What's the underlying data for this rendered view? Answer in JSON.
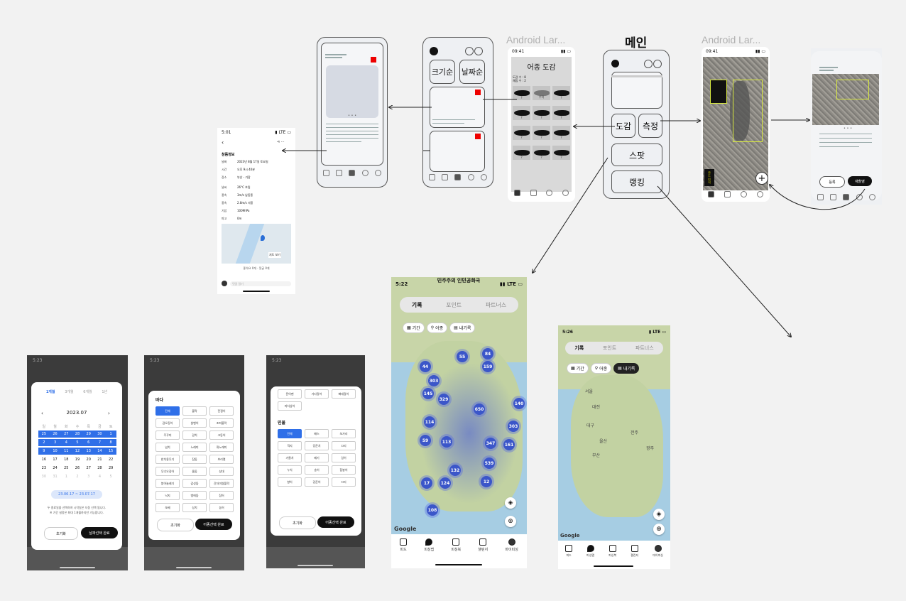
{
  "labels": {
    "android_1": "Android Lar...",
    "android_2": "Android Lar...",
    "main": "메인"
  },
  "wire_main": {
    "btn_dogam": "도감",
    "btn_measure": "측정",
    "btn_spot": "스팟",
    "btn_ranking": "랭킹"
  },
  "wire_sort": {
    "btn_size": "크기순",
    "btn_date": "날짜순"
  },
  "dogam": {
    "status_time": "09:41",
    "title": "어종 도감",
    "sub1": "도감 수 : 8",
    "sub2": "채집 수 : 2",
    "fish_captions": [
      "?",
      "우럭",
      "?",
      "?",
      "?",
      "?",
      "?",
      "?",
      "?",
      "?",
      "?",
      "?"
    ]
  },
  "measure": {
    "status_time": "09:41",
    "badge": "카드 인식"
  },
  "result": {
    "btn_register": "등록",
    "btn_retake": "재촬영"
  },
  "detail": {
    "status_time": "5:01",
    "title": "참돔정보",
    "rows": [
      {
        "k": "날짜",
        "v": "2023년 8월 17일 토요일"
      },
      {
        "k": "시간",
        "v": "오후 9시 40분"
      },
      {
        "k": "장소",
        "v": "부산 - 기장"
      },
      {
        "k": "날씨",
        "v": "26°C 흐림"
      },
      {
        "k": "풍속",
        "v": "3m/s 남동풍"
      },
      {
        "k": "풍속",
        "v": "2.8m/s 서풍"
      },
      {
        "k": "기압",
        "v": "1009hPa"
      },
      {
        "k": "파고",
        "v": "0m"
      },
      {
        "k": "물때",
        "v": "7물 썰물"
      }
    ],
    "map_note": "지도 보기",
    "footer": "좋아요 0개 · 댓글 0개",
    "comment_placeholder": "댓글 달기"
  },
  "bigmap": {
    "status_time": "5:22",
    "network": "LTE",
    "map_title": "민주주의 인민공화국",
    "tabs": [
      "기록",
      "포인트",
      "파트너스"
    ],
    "chips": [
      "기간",
      "어종",
      "내기록"
    ],
    "clusters": [
      "44",
      "55",
      "84",
      "303",
      "145",
      "329",
      "159",
      "650",
      "140",
      "114",
      "59",
      "113",
      "347",
      "303",
      "161",
      "132",
      "539",
      "17",
      "124",
      "12",
      "108"
    ],
    "google": "Google",
    "bottom_tabs": [
      "피드",
      "피싱맵",
      "피싱북",
      "챌린지",
      "마이피싱"
    ]
  },
  "smallmap": {
    "status_time": "5:26",
    "tabs": [
      "기록",
      "포인트",
      "파트너스"
    ],
    "chips": [
      "기간",
      "어종",
      "내기록"
    ],
    "cities": [
      "서울",
      "대전",
      "대구",
      "울산",
      "부산",
      "전주",
      "광주"
    ],
    "google": "Google",
    "bottom_tabs": [
      "피드",
      "피싱맵",
      "피싱북",
      "챌린지",
      "마이피싱"
    ]
  },
  "modal_date": {
    "time": "5:23",
    "periods": [
      "1개월",
      "3개월",
      "6개월",
      "1년"
    ],
    "month": "2023.07",
    "weekdays": [
      "일",
      "월",
      "화",
      "수",
      "목",
      "금",
      "토"
    ],
    "days": [
      "25",
      "26",
      "27",
      "28",
      "29",
      "30",
      "1",
      "2",
      "3",
      "4",
      "5",
      "6",
      "7",
      "8",
      "9",
      "10",
      "11",
      "12",
      "13",
      "14",
      "15",
      "16",
      "17",
      "18",
      "19",
      "20",
      "21",
      "22",
      "23",
      "24",
      "25",
      "26",
      "27",
      "28",
      "29",
      "30",
      "31",
      "1",
      "2",
      "3",
      "4",
      "5"
    ],
    "range": "23.06.17 ~ 23.07.17",
    "note1": "두 종료일을 선택하여 시작일은 자동 선택 됩니다.",
    "note2": "※ 기간 설정은 최대 1개월까지만 가능합니다.",
    "btn_reset": "초기화",
    "btn_done": "날짜선택 완료"
  },
  "modal_sea": {
    "time": "5:23",
    "section": "바다",
    "items": [
      "전체",
      "볼락",
      "전갱이",
      "갑오징어",
      "살벤어",
      "조피볼락",
      "주꾸미",
      "갈치",
      "고등어",
      "넙치",
      "노래미",
      "쥐노래미",
      "한치용무기",
      "참돔",
      "보리멸",
      "무너오징어",
      "돌돔",
      "성대",
      "붕어놀래기",
      "감성돔",
      "간자미쌍볼락",
      "낙지",
      "벵에돔",
      "참어",
      "쏘베",
      "성치",
      "농어"
    ],
    "btn_reset": "초기화",
    "btn_done": "어종선택 완료"
  },
  "modal_fresh": {
    "time": "5:23",
    "top_items": [
      "문어팬",
      "가다랑어",
      "삐대갈이",
      "까치상어"
    ],
    "section": "민물",
    "items": [
      "전체",
      "배스",
      "쏘가리",
      "꺽지",
      "강준치",
      "끄리",
      "가물치",
      "메기",
      "잉어",
      "누치",
      "송어",
      "참붕어",
      "향어",
      "강준어",
      "끄리"
    ],
    "btn_reset": "초기화",
    "btn_done": "어종선택 완료"
  }
}
